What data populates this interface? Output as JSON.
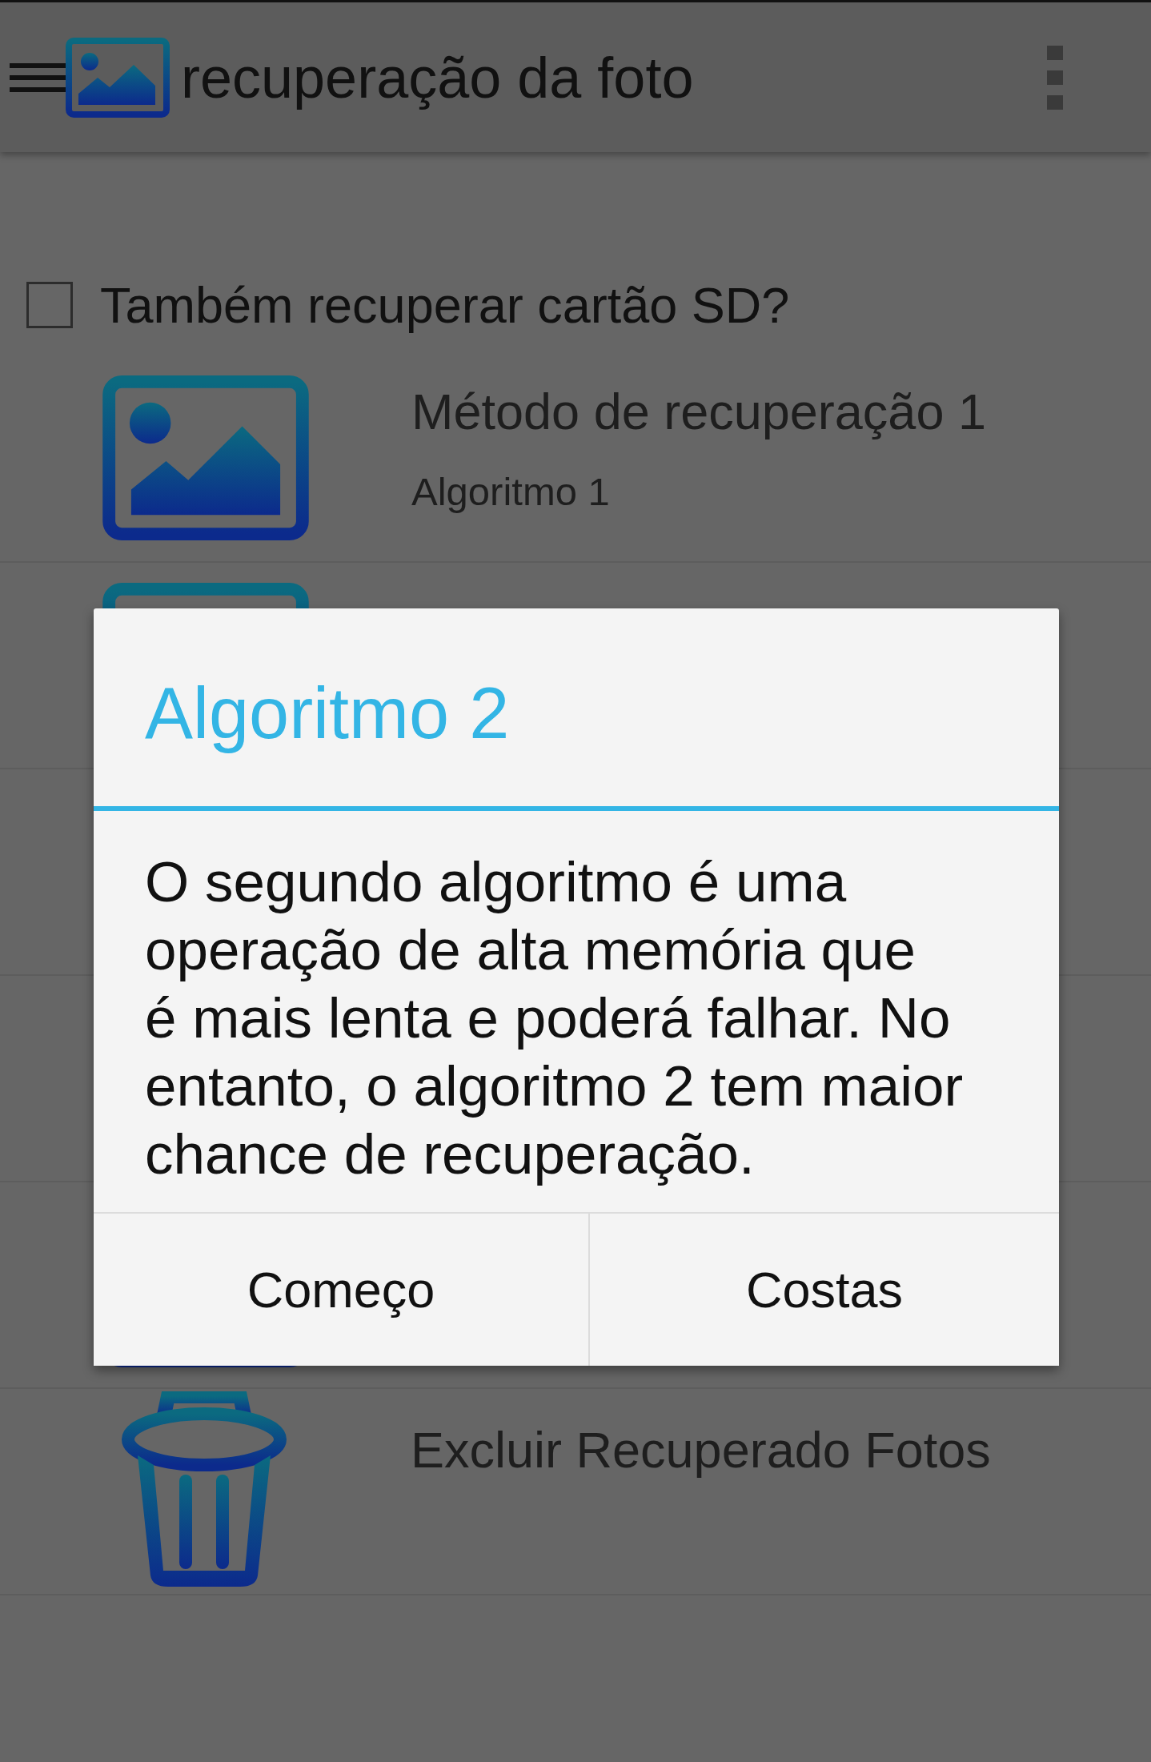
{
  "app_bar": {
    "title": "recuperação da foto"
  },
  "sd_option": {
    "label": "Também recuperar cartão SD?",
    "checked": false
  },
  "methods": [
    {
      "title": "Método de recuperação 1",
      "subtitle": "Algoritmo 1"
    }
  ],
  "delete_item": {
    "title": "Excluir Recuperado Fotos"
  },
  "dialog": {
    "title": "Algoritmo 2",
    "message_lines": [
      "O segundo algoritmo é uma",
      "operação de alta memória que",
      "é mais lenta e poderá falhar. No",
      "entanto, o algoritmo 2 tem maior",
      "chance de recuperação."
    ],
    "buttons": [
      "Começo",
      "Costas"
    ]
  }
}
